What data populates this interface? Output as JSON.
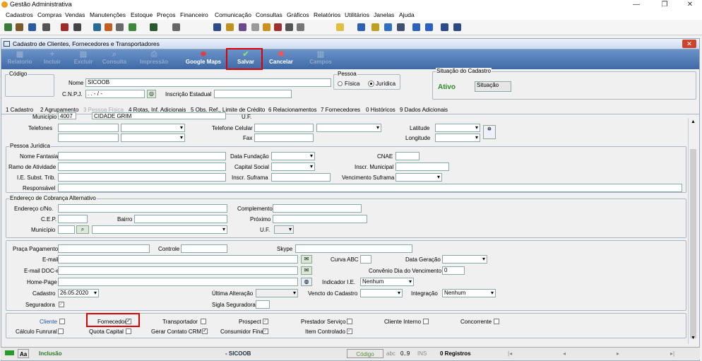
{
  "app": {
    "title": "Gestão Administrativa",
    "min": "—",
    "max": "❐",
    "close": "✕"
  },
  "menu": [
    "Cadastros",
    "Compras",
    "Vendas",
    "Manutenções",
    "Estoque",
    "Preços",
    "Financeiro",
    "Comunicação",
    "Consultas",
    "Gráficos",
    "Relatórios",
    "Utilitários",
    "Janelas",
    "Ajuda"
  ],
  "form": {
    "title": "Cadastro de Clientes, Fornecedores e Transportadores",
    "close": "✕"
  },
  "ribbon": [
    "Relatorio",
    "Incluir",
    "Excluir",
    "Consulta",
    "Impressão",
    "Google Maps",
    "Salvar",
    "Cancelar",
    "Campos"
  ],
  "top": {
    "codigo_label": "Código",
    "nome_label": "Nome",
    "nome_value": "SICOOB",
    "cnpj_label": "C.N.P.J.",
    "cnpj_value": ". . - / -",
    "ie_label": "Inscrição Estadual",
    "pessoa_label": "Pessoa",
    "fisica": "Física",
    "juridica": "Jurídica",
    "situacao_label": "Situação do Cadastro",
    "situacao_value": "Ativo",
    "situacao_btn": "Situação"
  },
  "tabs": [
    "1 Cadastro",
    "2 Agrupamento",
    "3 Pessoa Física",
    "4 Rotas, Inf. Adicionais",
    "5 Obs. Ref., Limite de Crédito",
    "6 Relacionamentos",
    "7 Fornecedores",
    "0 Históricos",
    "9 Dados Adicionais"
  ],
  "addr": {
    "municipio_label": "Município",
    "municipio_code": "4007",
    "municipio_name": "CIDADE GRIM",
    "uf": "U.F.",
    "telefones": "Telefones",
    "tel_celular": "Telefone Celular",
    "fax": "Fax",
    "latitude": "Latitude",
    "longitude": "Longitude"
  },
  "pj": {
    "title": "Pessoa Jurídica",
    "nome_fantasia": "Nome Fantasia",
    "ramo": "Ramo de Atividade",
    "ie_subst": "I.E. Subst. Trib.",
    "responsavel": "Responsável",
    "data_fundacao": "Data Fundação",
    "capital": "Capital Social",
    "suframa": "Inscr. Suframa",
    "cnae": "CNAE",
    "municipal": "Inscr. Municipal",
    "venc_suframa": "Vencimento Suframa"
  },
  "cob": {
    "title": "Endereço de Cobrança Alternativo",
    "endereco": "Endereço c/No.",
    "cep": "C.E.P.",
    "bairro": "Bairro",
    "municipio": "Município",
    "complemento": "Complemento",
    "proximo": "Próximo",
    "uf": "U.F."
  },
  "misc": {
    "praca": "Praça Pagamento",
    "controle": "Controle",
    "skype": "Skype",
    "email": "E-mail",
    "email_doc": "E-mail DOC-e",
    "homepage": "Home-Page",
    "cadastro": "Cadastro",
    "cadastro_value": "26.05.2020",
    "seguradora": "Seguradora",
    "curva": "Curva ABC",
    "data_geracao": "Data Geração",
    "convenio": "Convênio Dia do Vencimento",
    "convenio_value": "0",
    "indicador": "Indicador I.E.",
    "indicador_value": "Nenhum",
    "ultima": "Última Alteração",
    "vencto": "Vencto do Cadastro",
    "integracao": "Integração",
    "integracao_value": "Nenhum",
    "sigla": "Sigla Seguradora"
  },
  "checks": {
    "cliente": "Cliente",
    "fornecedor": "Fornecedor",
    "transportador": "Transportador",
    "prospect": "Prospect",
    "prestador": "Prestador Serviço",
    "cliente_interno": "Cliente Interno",
    "concorrente": "Concorrente",
    "calculo": "Cálculo Funrural",
    "quota": "Quota Capital",
    "gerar": "Gerar Contato CRM",
    "consumidor": "Consumidor Final",
    "item": "Item Controlado"
  },
  "status": {
    "aa": "Aa",
    "mode": "Inclusão",
    "name": "- SICOOB",
    "codigo": "Código",
    "abc": "abc",
    "range": "0..9",
    "ins": "INS",
    "registros": "0 Registros"
  }
}
